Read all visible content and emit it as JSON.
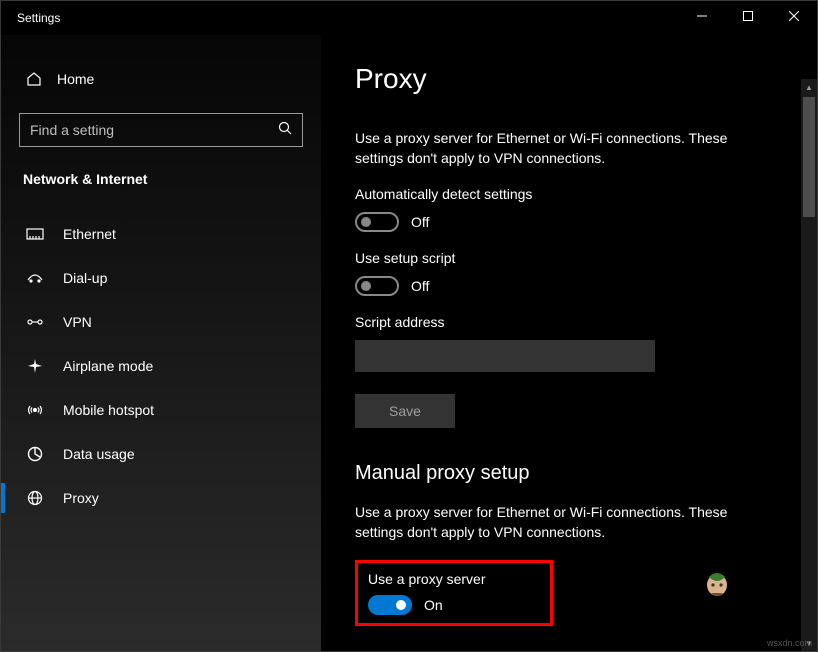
{
  "titlebar": {
    "title": "Settings"
  },
  "sidebar": {
    "home_label": "Home",
    "search_placeholder": "Find a setting",
    "section_label": "Network & Internet",
    "items": [
      {
        "label": "Ethernet",
        "icon": "ethernet-icon"
      },
      {
        "label": "Dial-up",
        "icon": "dialup-icon"
      },
      {
        "label": "VPN",
        "icon": "vpn-icon"
      },
      {
        "label": "Airplane mode",
        "icon": "airplane-icon"
      },
      {
        "label": "Mobile hotspot",
        "icon": "hotspot-icon"
      },
      {
        "label": "Data usage",
        "icon": "datausage-icon"
      },
      {
        "label": "Proxy",
        "icon": "proxy-icon"
      }
    ],
    "selected_index": 6
  },
  "main": {
    "title": "Proxy",
    "auto_desc": "Use a proxy server for Ethernet or Wi-Fi connections. These settings don't apply to VPN connections.",
    "auto_detect_label": "Automatically detect settings",
    "auto_detect_state": "Off",
    "setup_script_label": "Use setup script",
    "setup_script_state": "Off",
    "script_address_label": "Script address",
    "script_address_value": "",
    "save_label": "Save",
    "manual_heading": "Manual proxy setup",
    "manual_desc": "Use a proxy server for Ethernet or Wi-Fi connections. These settings don't apply to VPN connections.",
    "use_proxy_label": "Use a proxy server",
    "use_proxy_state": "On"
  },
  "watermark": "wsxdn.com"
}
